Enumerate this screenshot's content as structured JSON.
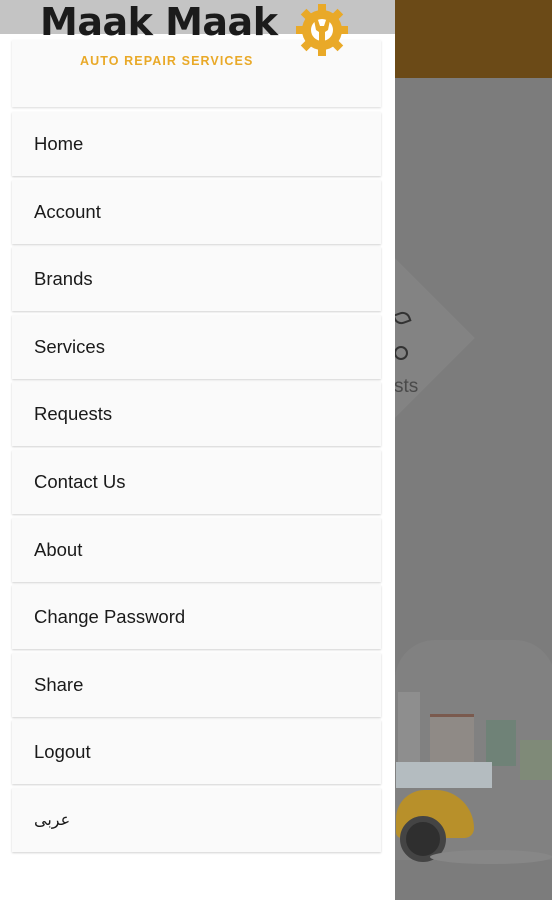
{
  "logo": {
    "title": "Maak Maak",
    "subtitle": "AUTO REPAIR SERVICES",
    "icon": "gear-wrench-icon",
    "brand_color": "#e9a928"
  },
  "menu": {
    "items": [
      {
        "label": "Home"
      },
      {
        "label": "Account"
      },
      {
        "label": "Brands"
      },
      {
        "label": "Services"
      },
      {
        "label": "Requests"
      },
      {
        "label": "Contact Us"
      },
      {
        "label": "About"
      },
      {
        "label": "Change Password"
      },
      {
        "label": "Share"
      },
      {
        "label": "Logout"
      },
      {
        "label": "عربى"
      }
    ]
  },
  "background": {
    "tile_label": "sts"
  }
}
